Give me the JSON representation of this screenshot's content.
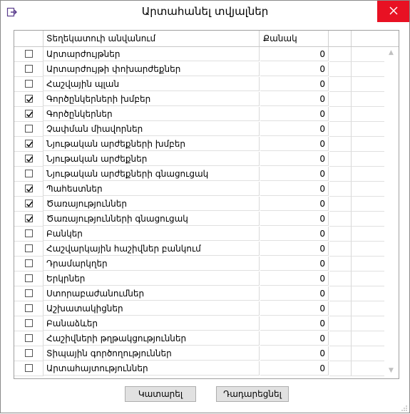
{
  "window": {
    "title": "Արտահանել տվյալներ"
  },
  "grid": {
    "headers": [
      "",
      "Տեղեկատուի անվանում",
      "Քանակ",
      "",
      ""
    ],
    "rows": [
      {
        "label": "Արտարժույթներ",
        "qty": "0",
        "checked": false
      },
      {
        "label": "Արտարժույթի փոխարժեքներ",
        "qty": "0",
        "checked": false
      },
      {
        "label": "Հաշվային պլան",
        "qty": "0",
        "checked": false
      },
      {
        "label": "Գործընկերների խմբեր",
        "qty": "0",
        "checked": true
      },
      {
        "label": "Գործընկերներ",
        "qty": "0",
        "checked": true
      },
      {
        "label": "Չափման միավորներ",
        "qty": "0",
        "checked": false
      },
      {
        "label": "Նյութական արժեքների խմբեր",
        "qty": "0",
        "checked": true
      },
      {
        "label": "Նյութական արժեքներ",
        "qty": "0",
        "checked": true
      },
      {
        "label": "Նյութական արժեքների գնացուցակ",
        "qty": "0",
        "checked": false
      },
      {
        "label": "Պահեստներ",
        "qty": "0",
        "checked": true
      },
      {
        "label": "Ծառայություններ",
        "qty": "0",
        "checked": true
      },
      {
        "label": "Ծառայությունների գնացուցակ",
        "qty": "0",
        "checked": true
      },
      {
        "label": "Բանկեր",
        "qty": "0",
        "checked": false
      },
      {
        "label": "Հաշվարկային հաշիվներ բանկում",
        "qty": "0",
        "checked": false
      },
      {
        "label": "Դրամարկղեր",
        "qty": "0",
        "checked": false
      },
      {
        "label": "Երկրներ",
        "qty": "0",
        "checked": false
      },
      {
        "label": "Ստորաբաժանումներ",
        "qty": "0",
        "checked": false
      },
      {
        "label": "Աշխատակիցներ",
        "qty": "0",
        "checked": false
      },
      {
        "label": "Բանաձևեր",
        "qty": "0",
        "checked": false
      },
      {
        "label": "Հաշիվների թղթակցություններ",
        "qty": "0",
        "checked": false
      },
      {
        "label": "Տիպային գործողություններ",
        "qty": "0",
        "checked": false
      },
      {
        "label": "Արտահայտություններ",
        "qty": "0",
        "checked": false
      }
    ]
  },
  "buttons": {
    "ok": "Կատարել",
    "cancel": "Դադարեցնել"
  },
  "icons": {
    "app": "export-icon",
    "close": "close-icon",
    "check": "checkmark-icon"
  },
  "colors": {
    "close_bg": "#e81123",
    "button_bg": "#e1e1e1"
  }
}
